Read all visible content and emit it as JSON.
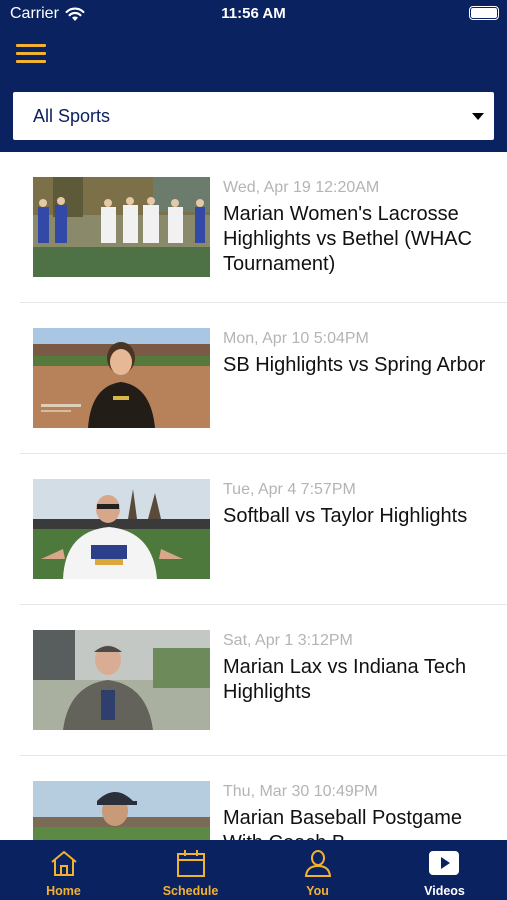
{
  "status_bar": {
    "carrier": "Carrier",
    "time": "11:56 AM"
  },
  "filter": {
    "selected": "All Sports"
  },
  "videos": [
    {
      "date": "Wed, Apr 19 12:20AM",
      "title": "Marian Women's Lacrosse Highlights vs Bethel (WHAC Tournament)"
    },
    {
      "date": "Mon, Apr 10 5:04PM",
      "title": "SB Highlights vs Spring Arbor"
    },
    {
      "date": "Tue, Apr 4 7:57PM",
      "title": "Softball vs Taylor Highlights"
    },
    {
      "date": "Sat, Apr 1 3:12PM",
      "title": "Marian Lax vs Indiana Tech Highlights"
    },
    {
      "date": "Thu, Mar 30 10:49PM",
      "title": "Marian Baseball Postgame With Coach B"
    }
  ],
  "tabs": [
    {
      "label": "Home",
      "icon": "home-icon"
    },
    {
      "label": "Schedule",
      "icon": "calendar-icon"
    },
    {
      "label": "You",
      "icon": "person-icon"
    },
    {
      "label": "Videos",
      "icon": "play-icon",
      "active": true
    }
  ],
  "colors": {
    "navy": "#0b2260",
    "gold": "#f2b230",
    "date_gray": "#b4b4b4"
  }
}
